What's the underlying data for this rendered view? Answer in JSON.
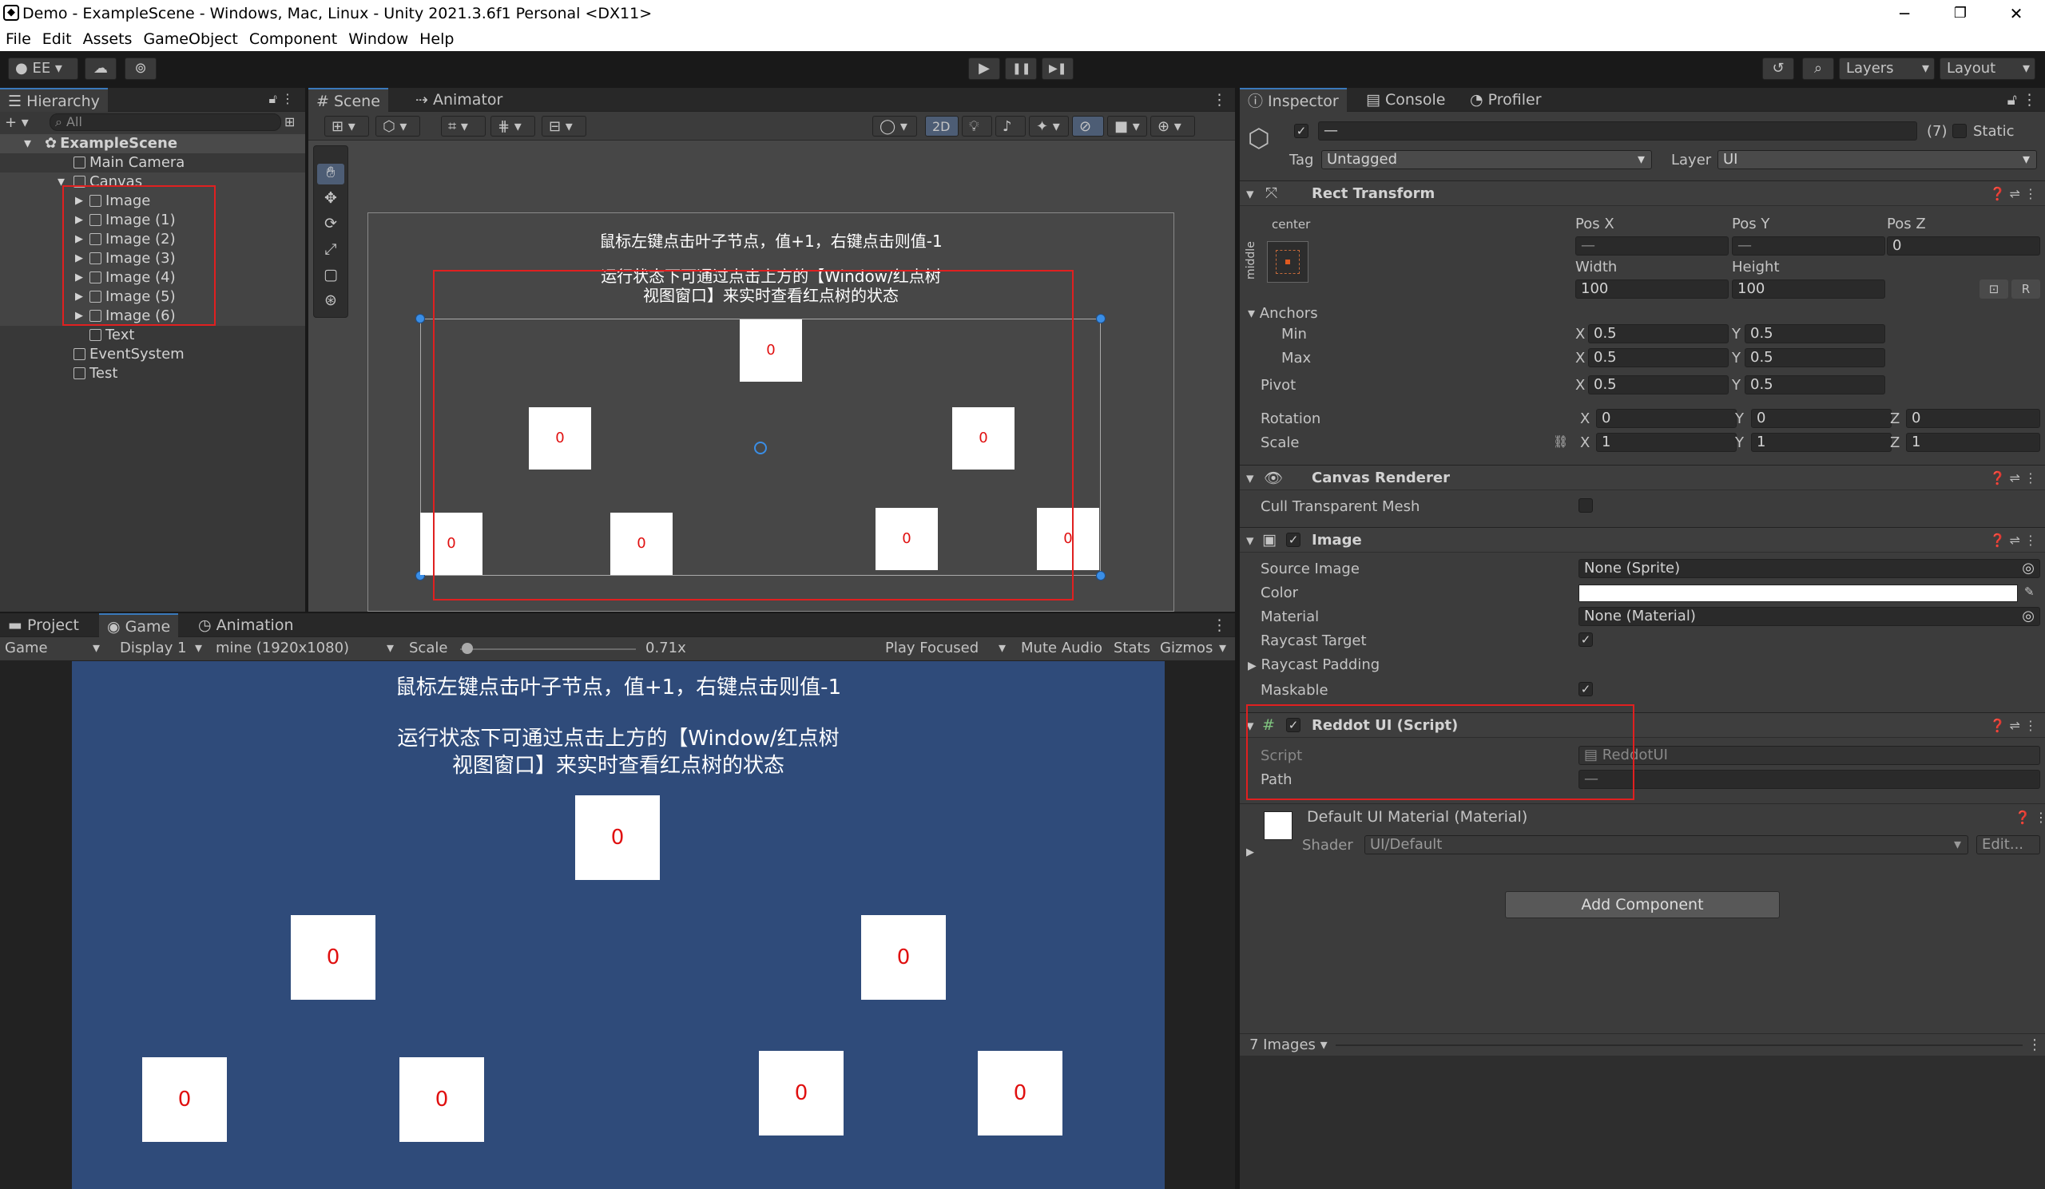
{
  "window": {
    "title": "Demo - ExampleScene - Windows, Mac, Linux - Unity 2021.3.6f1 Personal <DX11>",
    "min": "─",
    "max": "❐",
    "close": "✕"
  },
  "menu": [
    "File",
    "Edit",
    "Assets",
    "GameObject",
    "Component",
    "Window",
    "Help"
  ],
  "toolbar": {
    "account": "EE ▾",
    "play": "▶",
    "pause": "❚❚",
    "step": "▶❚",
    "layers": "Layers",
    "layout": "Layout"
  },
  "hierarchy": {
    "tab": "Hierarchy",
    "search": "All",
    "add": "+ ▾",
    "items": [
      {
        "label": "ExampleScene"
      },
      {
        "label": "Main Camera"
      },
      {
        "label": "Canvas"
      },
      {
        "label": "Image"
      },
      {
        "label": "Image (1)"
      },
      {
        "label": "Image (2)"
      },
      {
        "label": "Image (3)"
      },
      {
        "label": "Image (4)"
      },
      {
        "label": "Image (5)"
      },
      {
        "label": "Image (6)"
      },
      {
        "label": "Text"
      },
      {
        "label": "EventSystem"
      },
      {
        "label": "Test"
      }
    ]
  },
  "scene": {
    "tab_scene": "Scene",
    "tab_animator": "Animator",
    "btn_2d": "2D",
    "text1": "鼠标左键点击叶子节点，值+1，右键点击则值-1",
    "text2": "运行状态下可通过点击上方的【Window/红点树",
    "text3": "视图窗口】来实时查看红点树的状态",
    "node_value": "0"
  },
  "bottom_tabs": {
    "project": "Project",
    "game": "Game",
    "animation": "Animation"
  },
  "game": {
    "display_mode": "Game",
    "display": "Display 1",
    "resolution": "mine (1920x1080)",
    "scale_label": "Scale",
    "scale_value": "0.71x",
    "play_focused": "Play Focused",
    "mute": "Mute Audio",
    "stats": "Stats",
    "gizmos": "Gizmos",
    "text1": "鼠标左键点击叶子节点，值+1，右键点击则值-1",
    "text2": "运行状态下可通过点击上方的【Window/红点树",
    "text3": "视图窗口】来实时查看红点树的状态",
    "node_value": "0"
  },
  "inspector": {
    "tab_inspector": "Inspector",
    "tab_console": "Console",
    "tab_profiler": "Profiler",
    "name_value": "—",
    "count": "(7)",
    "static": "Static",
    "tag_label": "Tag",
    "tag_value": "Untagged",
    "layer_label": "Layer",
    "layer_value": "UI",
    "rect": {
      "title": "Rect Transform",
      "anchor_preset": "center",
      "anchor_side": "middle",
      "posx": "Pos X",
      "posy": "Pos Y",
      "posz": "Pos Z",
      "posx_v": "—",
      "posy_v": "—",
      "posz_v": "0",
      "width": "Width",
      "height": "Height",
      "width_v": "100",
      "height_v": "100",
      "r_btn": "R",
      "anchors": "Anchors",
      "min": "Min",
      "max": "Max",
      "pivot": "Pivot",
      "x": "X",
      "y": "Y",
      "z": "Z",
      "v05": "0.5",
      "rotation": "Rotation",
      "scale": "Scale",
      "rot_v": "0",
      "scale_v": "1"
    },
    "canvas_renderer": {
      "title": "Canvas Renderer",
      "cull": "Cull Transparent Mesh"
    },
    "image": {
      "title": "Image",
      "source": "Source Image",
      "source_v": "None (Sprite)",
      "color": "Color",
      "material": "Material",
      "material_v": "None (Material)",
      "raycast": "Raycast Target",
      "padding": "Raycast Padding",
      "maskable": "Maskable"
    },
    "reddot": {
      "title": "Reddot UI (Script)",
      "script": "Script",
      "script_v": "ReddotUI",
      "path": "Path",
      "path_v": "—"
    },
    "material": {
      "title": "Default UI Material (Material)",
      "shader": "Shader",
      "shader_v": "UI/Default",
      "edit": "Edit..."
    },
    "add_component": "Add Component",
    "images_count": "7 Images ▾"
  },
  "colors": {
    "accent": "#3a79bb",
    "highlight": "#e02020",
    "game_bg": "#2f4b7a",
    "node_text": "#e01010"
  }
}
